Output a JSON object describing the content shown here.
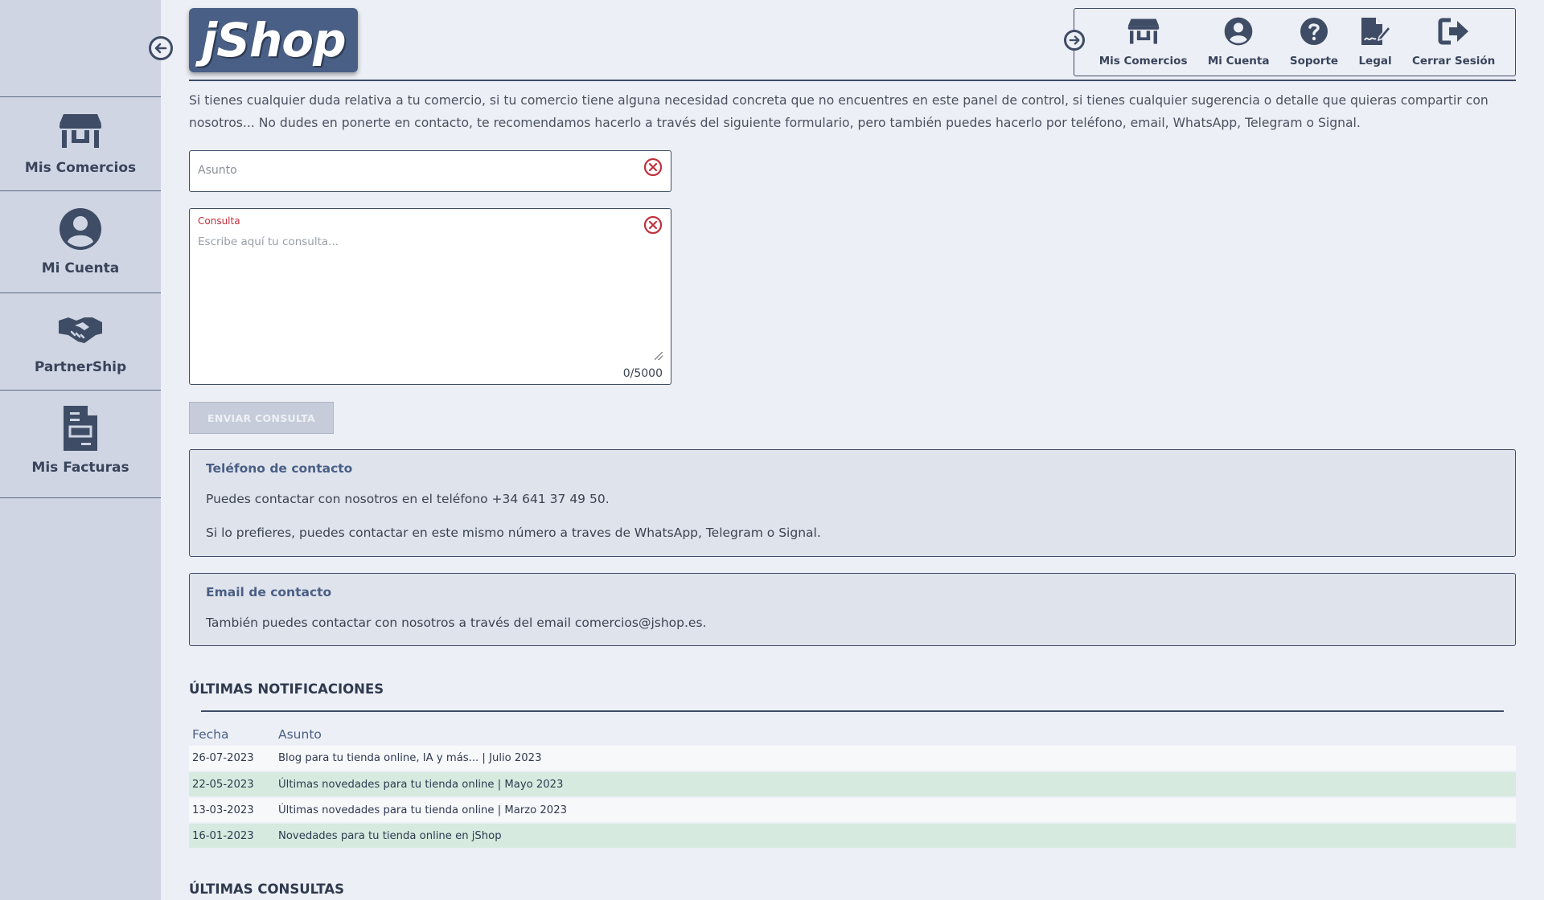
{
  "sidebar": {
    "items": [
      {
        "label": "Mis Comercios",
        "icon": "store-icon"
      },
      {
        "label": "Mi Cuenta",
        "icon": "user-circle-icon"
      },
      {
        "label": "PartnerShip",
        "icon": "handshake-icon"
      },
      {
        "label": "Mis Facturas",
        "icon": "invoice-icon"
      }
    ]
  },
  "header": {
    "logo_text": "jShop",
    "nav": [
      {
        "label": "Mis Comercios",
        "icon": "store-icon"
      },
      {
        "label": "Mi Cuenta",
        "icon": "user-circle-icon"
      },
      {
        "label": "Soporte",
        "icon": "question-circle-icon"
      },
      {
        "label": "Legal",
        "icon": "signed-document-icon"
      },
      {
        "label": "Cerrar Sesión",
        "icon": "logout-icon"
      }
    ]
  },
  "main": {
    "intro": "Si tienes cualquier duda relativa a tu comercio, si tu comercio tiene alguna necesidad concreta que no encuentres en este panel de control, si tienes cualquier sugerencia o detalle que quieras compartir con nosotros... No dudes en ponerte en contacto, te recomendamos hacerlo a través del siguiente formulario, pero también puedes hacerlo por teléfono, email, WhatsApp, Telegram o Signal.",
    "form": {
      "asunto_placeholder": "Asunto",
      "asunto_value": "",
      "consulta_label": "Consulta",
      "consulta_placeholder": "Escribe aquí tu consulta...",
      "consulta_value": "",
      "counter": "0/5000",
      "submit_label": "ENVIAR CONSULTA"
    },
    "phone_card": {
      "title": "Teléfono de contacto",
      "line1": "Puedes contactar con nosotros en el teléfono +34 641 37 49 50.",
      "line2": "Si lo prefieres, puedes contactar en este mismo número a traves de WhatsApp, Telegram o Signal."
    },
    "email_card": {
      "title": "Email de contacto",
      "line1": "También puedes contactar con nosotros a través del email comercios@jshop.es."
    },
    "notifications": {
      "title": "ÚLTIMAS NOTIFICACIONES",
      "columns": [
        "Fecha",
        "Asunto"
      ],
      "rows": [
        {
          "date": "26-07-2023",
          "subject": "Blog para tu tienda online, IA y más... | Julio 2023"
        },
        {
          "date": "22-05-2023",
          "subject": "Últimas novedades para tu tienda online | Mayo 2023"
        },
        {
          "date": "13-03-2023",
          "subject": "Últimas novedades para tu tienda online | Marzo 2023"
        },
        {
          "date": "16-01-2023",
          "subject": "Novedades para tu tienda online en jShop"
        }
      ]
    },
    "consultas_title": "ÚLTIMAS CONSULTAS"
  },
  "colors": {
    "primary": "#4a5f85",
    "sidebar_bg": "#cfd5e3",
    "page_bg": "#eceff5",
    "error": "#c0303b",
    "row_highlight": "#d6eadf"
  }
}
